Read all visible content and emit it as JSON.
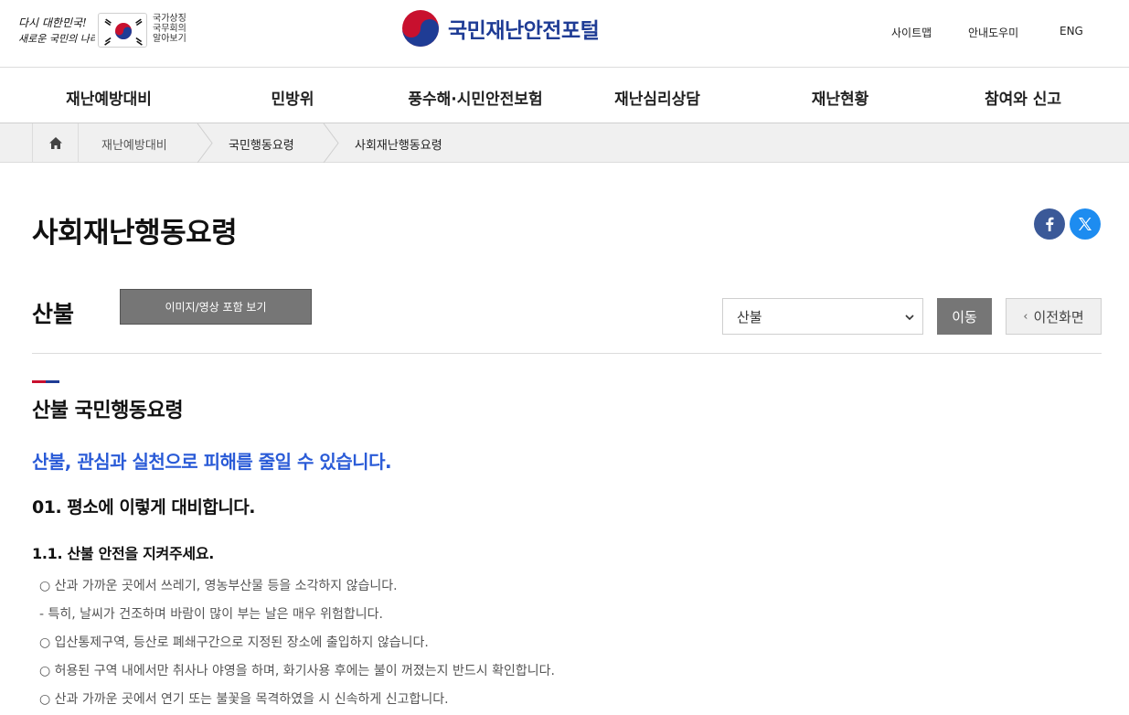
{
  "header": {
    "slogan": [
      "다시 대한민국!",
      "새로운 국민의 나라"
    ],
    "gov_link": [
      "국가상징",
      "국무회의",
      "알아보기"
    ],
    "site_title": "국민재난안전포털",
    "util": [
      "사이트맵",
      "안내도우미",
      "ENG"
    ]
  },
  "gnb": [
    "재난예방대비",
    "민방위",
    "풍수해·시민안전보험",
    "재난심리상담",
    "재난현황",
    "참여와 신고"
  ],
  "breadcrumb": [
    "재난예방대비",
    "국민행동요령",
    "사회재난행동요령"
  ],
  "page": {
    "title": "사회재난행동요령",
    "subtitle": "산불",
    "media_button": "이미지/영상 포함 보기",
    "select_value": "산불",
    "go_button": "이동",
    "prev_button": "이전화면"
  },
  "content": {
    "section_title": "산불 국민행동요령",
    "lead": "산불, 관심과 실천으로 피해를 줄일 수 있습니다.",
    "h3": "01. 평소에 이렇게 대비합니다.",
    "h4": "1.1. 산불 안전을 지켜주세요.",
    "lines": [
      "○ 산과 가까운 곳에서 쓰레기, 영농부산물 등을 소각하지 않습니다.",
      " - 특히, 날씨가 건조하며 바람이 많이 부는 날은 매우 위험합니다.",
      "○ 입산통제구역, 등산로 폐쇄구간으로 지정된 장소에 출입하지 않습니다.",
      "○ 허용된 구역 내에서만 취사나 야영을 하며, 화기사용 후에는 불이 꺼졌는지 반드시 확인합니다.",
      "○ 산과 가까운 곳에서 연기 또는 불꽃을 목격하였을 시 신속하게 신고합니다."
    ]
  },
  "colors": {
    "brand_blue": "#1f3c95",
    "accent_red": "#c8102e",
    "lead_blue": "#2a5bd7",
    "button_gray": "#767676"
  }
}
